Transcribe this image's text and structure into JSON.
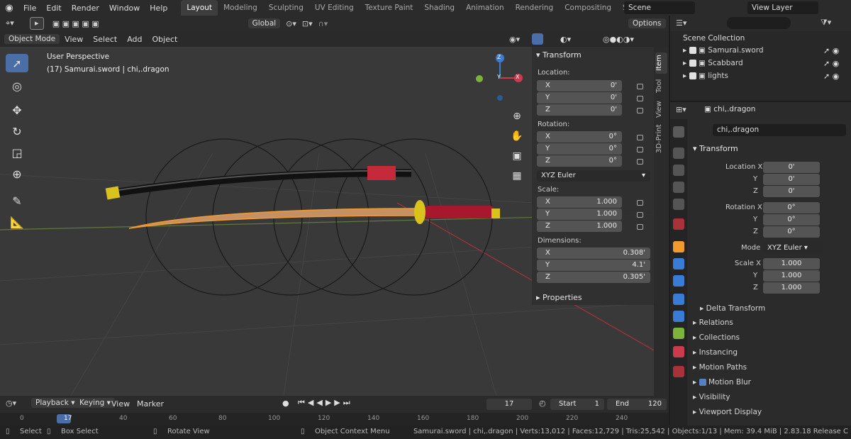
{
  "app": {
    "menus": [
      "File",
      "Edit",
      "Render",
      "Window",
      "Help"
    ],
    "workspaces": [
      "Layout",
      "Modeling",
      "Sculpting",
      "UV Editing",
      "Texture Paint",
      "Shading",
      "Animation",
      "Rendering",
      "Compositing",
      "Scripting"
    ],
    "active_workspace": "Layout",
    "scene": "Scene",
    "view_layer": "View Layer",
    "add_workspace": "+"
  },
  "viewport": {
    "orientation": "Global",
    "options": "Options",
    "header_menus": [
      "Object Mode",
      "View",
      "Select",
      "Add",
      "Object"
    ],
    "perspective": "User Perspective",
    "active_label": "(17) Samurai.sword | chi,.dragon",
    "gizmo": {
      "x": "X",
      "y": "Y",
      "z": "Z"
    }
  },
  "npanel": {
    "tabs": [
      "Item",
      "Tool",
      "View",
      "3D-Print"
    ],
    "transform_title": "Transform",
    "location_label": "Location:",
    "rotation_label": "Rotation:",
    "scale_label": "Scale:",
    "dimensions_label": "Dimensions:",
    "location": [
      {
        "a": "X",
        "v": "0'"
      },
      {
        "a": "Y",
        "v": "0'"
      },
      {
        "a": "Z",
        "v": "0'"
      }
    ],
    "rotation": [
      {
        "a": "X",
        "v": "0°"
      },
      {
        "a": "Y",
        "v": "0°"
      },
      {
        "a": "Z",
        "v": "0°"
      }
    ],
    "rotation_mode": "XYZ Euler",
    "scale": [
      {
        "a": "X",
        "v": "1.000"
      },
      {
        "a": "Y",
        "v": "1.000"
      },
      {
        "a": "Z",
        "v": "1.000"
      }
    ],
    "dimensions": [
      {
        "a": "X",
        "v": "0.308'"
      },
      {
        "a": "Y",
        "v": "4.1'"
      },
      {
        "a": "Z",
        "v": "0.305'"
      }
    ],
    "properties_title": "Properties"
  },
  "outliner": {
    "root": "Scene Collection",
    "items": [
      "Samurai.sword",
      "Scabbard",
      "lights"
    ]
  },
  "properties": {
    "object_name": "chi,.dragon",
    "object_field": "chi,.dragon",
    "transform_title": "Transform",
    "location_label": "Location X",
    "rotation_label": "Rotation X",
    "mode_label": "Mode",
    "scale_label": "Scale X",
    "y": "Y",
    "z": "Z",
    "location": [
      "0'",
      "0'",
      "0'"
    ],
    "rotation": [
      "0°",
      "0°",
      "0°"
    ],
    "mode": "XYZ Euler",
    "scale": [
      "1.000",
      "1.000",
      "1.000"
    ],
    "sections": [
      "Delta Transform",
      "Relations",
      "Collections",
      "Instancing",
      "Motion Paths",
      "Motion Blur",
      "Visibility",
      "Viewport Display"
    ]
  },
  "timeline": {
    "menus": [
      "Playback",
      "Keying",
      "View",
      "Marker"
    ],
    "current_frame": "17",
    "start_label": "Start",
    "start": "1",
    "end_label": "End",
    "end": "120",
    "ticks": [
      "0",
      "17",
      "40",
      "60",
      "80",
      "100",
      "120",
      "140",
      "160",
      "180",
      "200",
      "220",
      "240"
    ]
  },
  "status": {
    "select": "Select",
    "box_select": "Box Select",
    "rotate_view": "Rotate View",
    "context_menu": "Object Context Menu",
    "info": "Samurai.sword | chi,.dragon | Verts:13,012 | Faces:12,729 | Tris:25,542 | Objects:1/13 | Mem: 39.4 MiB | 2.83.18 Release C"
  },
  "colors": {
    "accent": "#4b6ea8",
    "x_axis": "#cc3b4d",
    "y_axis": "#7bb33b",
    "z_axis": "#3a7bd5",
    "orange": "#f29a2e"
  }
}
